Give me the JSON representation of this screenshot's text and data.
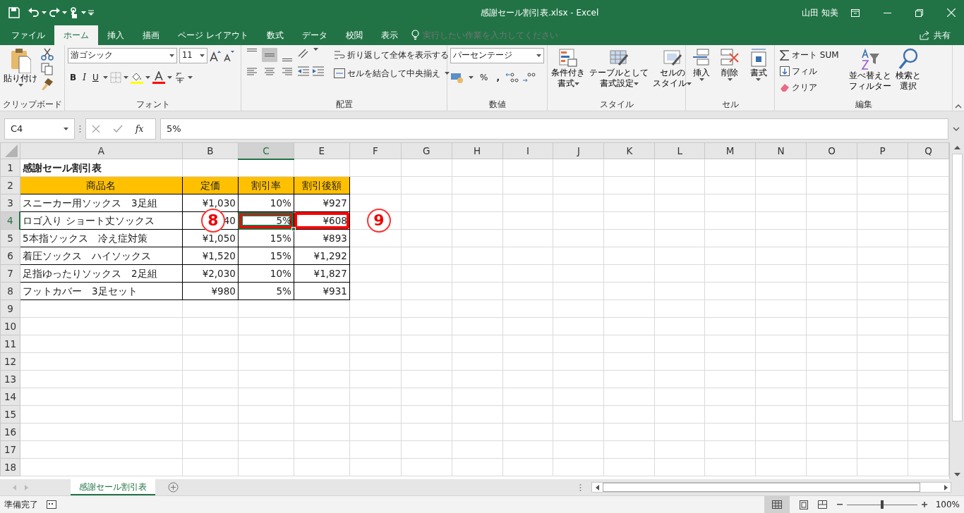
{
  "window": {
    "title": "感謝セール割引表.xlsx  -  Excel",
    "user": "山田 知美"
  },
  "ribbon_tabs": [
    {
      "label": "ファイル",
      "selected": false
    },
    {
      "label": "ホーム",
      "selected": true
    },
    {
      "label": "挿入",
      "selected": false
    },
    {
      "label": "描画",
      "selected": false
    },
    {
      "label": "ページ レイアウト",
      "selected": false
    },
    {
      "label": "数式",
      "selected": false
    },
    {
      "label": "データ",
      "selected": false
    },
    {
      "label": "校閲",
      "selected": false
    },
    {
      "label": "表示",
      "selected": false
    }
  ],
  "tell_me": {
    "placeholder": "実行したい作業を入力してください"
  },
  "share": "共有",
  "clipboard": {
    "paste": "貼り付け",
    "label": "クリップボード"
  },
  "font": {
    "name": "游ゴシック",
    "size": "11",
    "bold": "B",
    "italic": "I",
    "underline": "U",
    "label": "フォント"
  },
  "alignment": {
    "valign": [
      {
        "selected": false
      },
      {
        "selected": true
      },
      {
        "selected": false
      }
    ],
    "halign": [
      {
        "selected": false
      },
      {
        "selected": false
      },
      {
        "selected": false
      }
    ],
    "wrap": "折り返して全体を表示する",
    "merge": "セルを結合して中央揃え",
    "label": "配置"
  },
  "number": {
    "format": "パーセンテージ",
    "percent": "%",
    "comma": ",",
    "label": "数値"
  },
  "styles": {
    "buttons": [
      {
        "lines": [
          "条件付き",
          "書式"
        ],
        "kind": "conditional"
      },
      {
        "lines": [
          "テーブルとして",
          "書式設定"
        ],
        "kind": "table"
      },
      {
        "lines": [
          "セルの",
          "スタイル"
        ],
        "kind": "cellstyle"
      }
    ],
    "label": "スタイル"
  },
  "cells": {
    "buttons": [
      {
        "label": "挿入",
        "kind": "insert"
      },
      {
        "label": "削除",
        "kind": "delete"
      },
      {
        "label": "書式",
        "kind": "format"
      }
    ],
    "label": "セル"
  },
  "editing": {
    "autosum": "オート SUM",
    "fill": "フィル",
    "clear": "クリア",
    "sort": [
      "並べ替えと",
      "フィルター"
    ],
    "find": [
      "検索と",
      "選択"
    ],
    "label": "編集"
  },
  "formula_bar": {
    "name_box": "C4",
    "fx": "fx",
    "value": "5%"
  },
  "columns": [
    {
      "label": "A",
      "selected": false
    },
    {
      "label": "B",
      "selected": false
    },
    {
      "label": "C",
      "selected": true
    },
    {
      "label": "E",
      "selected": false
    },
    {
      "label": "F",
      "selected": false
    },
    {
      "label": "G",
      "selected": false
    },
    {
      "label": "H",
      "selected": false
    },
    {
      "label": "I",
      "selected": false
    },
    {
      "label": "J",
      "selected": false
    },
    {
      "label": "K",
      "selected": false
    },
    {
      "label": "L",
      "selected": false
    },
    {
      "label": "M",
      "selected": false
    },
    {
      "label": "N",
      "selected": false
    },
    {
      "label": "O",
      "selected": false
    },
    {
      "label": "P",
      "selected": false
    },
    {
      "label": "Q",
      "selected": false
    }
  ],
  "rows": [
    {
      "number": "1",
      "selected": false,
      "cells": [
        {
          "text": "感謝セール割引表",
          "kind": "title",
          "selected": false
        }
      ]
    },
    {
      "number": "2",
      "selected": false,
      "cells": [
        {
          "text": "商品名",
          "kind": "heading",
          "selected": false
        },
        {
          "text": "定価",
          "kind": "heading",
          "selected": false
        },
        {
          "text": "割引率",
          "kind": "heading",
          "selected": false
        },
        {
          "text": "割引後額",
          "kind": "heading",
          "selected": false
        }
      ]
    },
    {
      "number": "3",
      "selected": false,
      "cells": [
        {
          "text": "スニーカー用ソックス　3足組",
          "kind": "text",
          "selected": false
        },
        {
          "text": "¥1,030",
          "kind": "number",
          "selected": false
        },
        {
          "text": "10%",
          "kind": "number",
          "selected": false
        },
        {
          "text": "¥927",
          "kind": "number",
          "selected": false
        }
      ]
    },
    {
      "number": "4",
      "selected": true,
      "cells": [
        {
          "text": "ロゴ入り ショート丈ソックス",
          "kind": "text",
          "selected": false
        },
        {
          "text": "40",
          "kind": "number",
          "selected": false,
          "marker": "8"
        },
        {
          "text": "5%",
          "kind": "number",
          "selected": true,
          "highlighted": true
        },
        {
          "text": "¥608",
          "kind": "number",
          "selected": false,
          "highlighted": true
        },
        {
          "kind": "blank",
          "selected": false,
          "marker": "9"
        }
      ]
    },
    {
      "number": "5",
      "selected": false,
      "cells": [
        {
          "text": "5本指ソックス　冷え症対策",
          "kind": "text",
          "selected": false
        },
        {
          "text": "¥1,050",
          "kind": "number",
          "selected": false
        },
        {
          "text": "15%",
          "kind": "number",
          "selected": false
        },
        {
          "text": "¥893",
          "kind": "number",
          "selected": false
        }
      ]
    },
    {
      "number": "6",
      "selected": false,
      "cells": [
        {
          "text": "着圧ソックス　ハイソックス",
          "kind": "text",
          "selected": false
        },
        {
          "text": "¥1,520",
          "kind": "number",
          "selected": false
        },
        {
          "text": "15%",
          "kind": "number",
          "selected": false
        },
        {
          "text": "¥1,292",
          "kind": "number",
          "selected": false
        }
      ]
    },
    {
      "number": "7",
      "selected": false,
      "cells": [
        {
          "text": "足指ゆったりソックス　2足組",
          "kind": "text",
          "selected": false
        },
        {
          "text": "¥2,030",
          "kind": "number",
          "selected": false
        },
        {
          "text": "10%",
          "kind": "number",
          "selected": false
        },
        {
          "text": "¥1,827",
          "kind": "number",
          "selected": false
        }
      ]
    },
    {
      "number": "8",
      "selected": false,
      "cells": [
        {
          "text": "フットカバー　3足セット",
          "kind": "text",
          "selected": false
        },
        {
          "text": "¥980",
          "kind": "number",
          "selected": false
        },
        {
          "text": "5%",
          "kind": "number",
          "selected": false
        },
        {
          "text": "¥931",
          "kind": "number",
          "selected": false
        }
      ]
    },
    {
      "number": "9",
      "selected": false,
      "cells": []
    },
    {
      "number": "10",
      "selected": false,
      "cells": []
    },
    {
      "number": "11",
      "selected": false,
      "cells": []
    },
    {
      "number": "12",
      "selected": false,
      "cells": []
    },
    {
      "number": "13",
      "selected": false,
      "cells": []
    },
    {
      "number": "14",
      "selected": false,
      "cells": []
    },
    {
      "number": "15",
      "selected": false,
      "cells": []
    },
    {
      "number": "16",
      "selected": false,
      "cells": []
    },
    {
      "number": "17",
      "selected": false,
      "cells": []
    },
    {
      "number": "18",
      "selected": false,
      "cells": []
    }
  ],
  "sheet_tabs": [
    {
      "label": "感謝セール割引表",
      "selected": true
    }
  ],
  "status_bar": {
    "text": "準備完了",
    "zoom": "100%",
    "zoom_slider": {
      "level": 0.5
    }
  }
}
